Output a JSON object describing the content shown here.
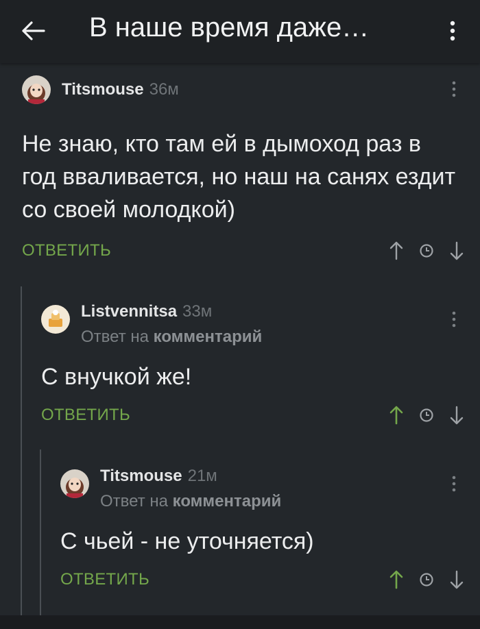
{
  "header": {
    "title": "В наше время даже…",
    "back_icon": "arrow-left-icon",
    "menu_icon": "more-vertical-icon"
  },
  "comments": [
    {
      "author": "Titsmouse",
      "time": "36м",
      "text": "Не знаю, кто там ей в дымоход раз в год вваливается, но наш на санях ездит со своей молодкой)",
      "reply_label": "ОТВЕТИТЬ",
      "reply_to": null,
      "voted_up": false
    },
    {
      "author": "Listvennitsa",
      "time": "33м",
      "reply_to_prefix": "Ответ на",
      "reply_to_link": "комментарий",
      "text": "С внучкой же!",
      "reply_label": "ОТВЕТИТЬ",
      "voted_up": true
    },
    {
      "author": "Titsmouse",
      "time": "21м",
      "reply_to_prefix": "Ответ на",
      "reply_to_link": "комментарий",
      "text": "С чьей - не уточняется)",
      "reply_label": "ОТВЕТИТЬ",
      "voted_up": true
    }
  ],
  "colors": {
    "background": "#23272b",
    "appbar": "#1e2124",
    "accent_green": "#74a74b",
    "muted": "#6f7478"
  }
}
